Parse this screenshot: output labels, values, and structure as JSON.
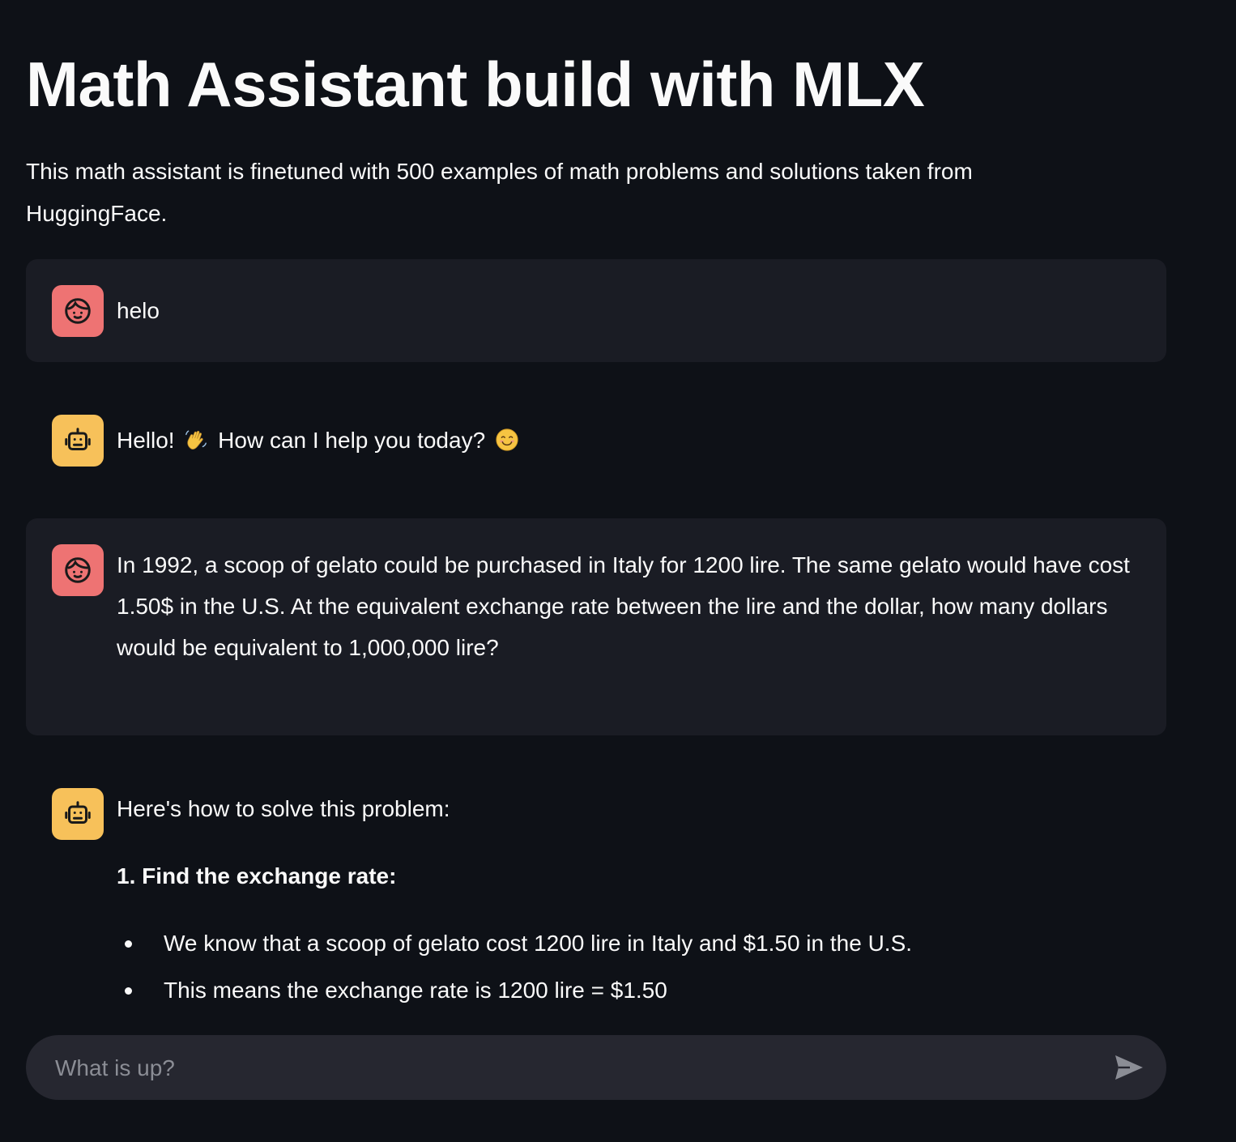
{
  "page": {
    "title": "Math Assistant build with MLX",
    "description": "This math assistant is finetuned with 500 examples of math problems and solutions taken from HuggingFace."
  },
  "messages": [
    {
      "role": "user",
      "avatar_icon": "user-face-icon",
      "text": "helo"
    },
    {
      "role": "assistant",
      "avatar_icon": "robot-icon",
      "text_before": "Hello!",
      "text_middle": "How can I help you today?",
      "emoji_1": "waving-hand-emoji",
      "emoji_2": "smiling-face-emoji"
    },
    {
      "role": "user",
      "avatar_icon": "user-face-icon",
      "line_1": "In 1992, a scoop of gelato could be purchased in Italy for 1200 lire. The same gelato would have cost",
      "line_2": "1.50$ in the U.S. At the equivalent exchange rate between the lire and the dollar, how many dollars would be equivalent to 1,000,000 lire?"
    },
    {
      "role": "assistant",
      "avatar_icon": "robot-icon",
      "intro": "Here's how to solve this problem:",
      "step_heading": "1. Find the exchange rate:",
      "bullets": [
        "We know that a scoop of gelato cost 1200 lire in Italy and $1.50 in the U.S.",
        "This means the exchange rate is 1200 lire = $1.50"
      ]
    }
  ],
  "chat_input": {
    "placeholder": "What is up?",
    "send_icon": "send-icon"
  },
  "colors": {
    "background": "#0e1117",
    "user_message_bg": "#1a1c24",
    "user_avatar": "#ee7373",
    "assistant_avatar": "#f7c15a",
    "input_bg": "#262730"
  }
}
